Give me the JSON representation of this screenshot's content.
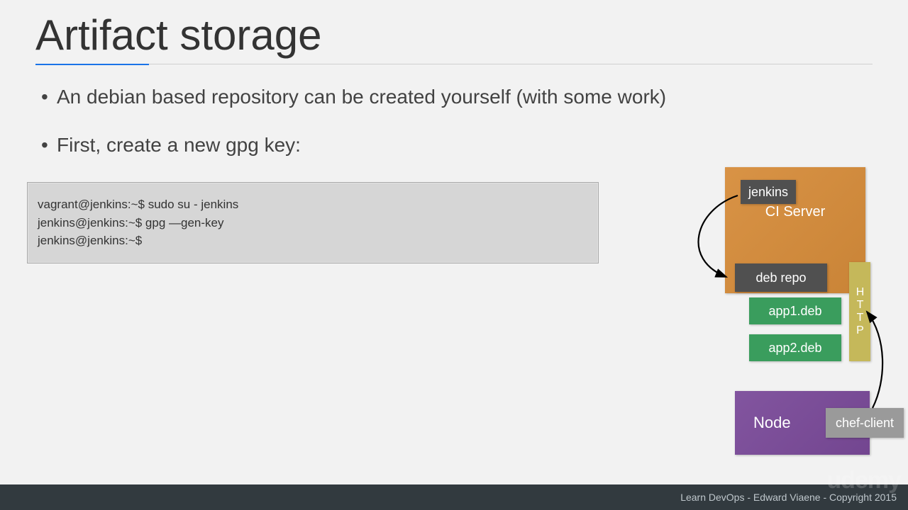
{
  "title": "Artifact storage",
  "bullets": [
    "An debian based repository can be created yourself (with some work)",
    "First, create a new gpg key:"
  ],
  "code": {
    "line1": "vagrant@jenkins:~$ sudo su - jenkins",
    "line2": "jenkins@jenkins:~$ gpg —gen-key",
    "line3": "jenkins@jenkins:~$"
  },
  "diagram": {
    "ci_server": "CI Server",
    "jenkins": "jenkins",
    "deb_repo": "deb repo",
    "app1": "app1.deb",
    "app2": "app2.deb",
    "http": "HTTP",
    "node": "Node",
    "chef": "chef-client"
  },
  "footer": "Learn DevOps - Edward Viaene - Copyright 2015",
  "watermark": "udemy"
}
